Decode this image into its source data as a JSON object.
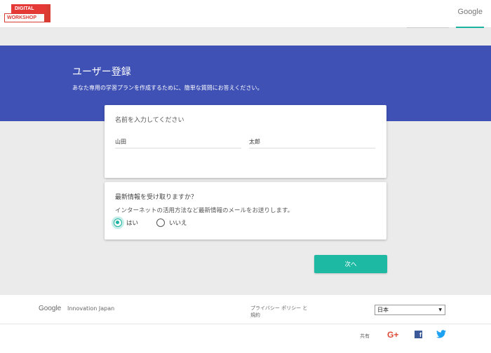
{
  "header": {
    "logo_top": "DIGITAL",
    "logo_bottom": "WORKSHOP",
    "brand": "Google"
  },
  "hero": {
    "title": "ユーザー登録",
    "subtitle": "あなた専用の学習プランを作成するために、簡単な質問にお答えください。"
  },
  "name_card": {
    "label": "名前を入力してください",
    "last_name_value": "山田",
    "first_name_value": "太郎"
  },
  "newsletter_card": {
    "question": "最新情報を受け取りますか？",
    "description": "インターネットの活用方法など最新情報のメールをお送りします。",
    "option_yes": "はい",
    "option_no": "いいえ",
    "selected": "はい"
  },
  "actions": {
    "next_label": "次へ"
  },
  "footer": {
    "google": "Google",
    "innovation": "Innovation Japan",
    "privacy": "プライバシー ポリシー と 規約",
    "language": "日本",
    "share_label": "共有",
    "icons": [
      "google-plus-icon",
      "facebook-icon",
      "twitter-icon"
    ]
  },
  "colors": {
    "hero_blue": "#3f51b5",
    "accent_teal": "#1db9a3",
    "logo_red": "#e53935"
  }
}
